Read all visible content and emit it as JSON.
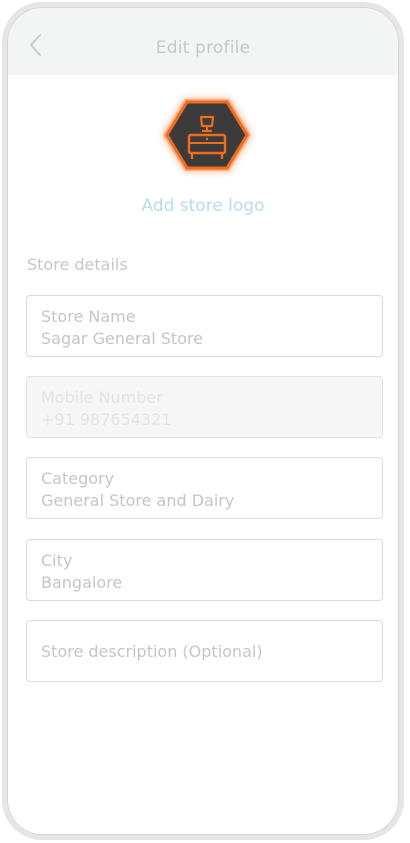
{
  "header": {
    "title": "Edit profile",
    "back_icon": "chevron-left-icon"
  },
  "logo": {
    "icon": "nightstand-lamp-icon",
    "accent_color": "#f26b1d",
    "add_label": "Add store logo"
  },
  "form": {
    "section_title": "Store details",
    "fields": [
      {
        "label": "Store Name",
        "value": "Sagar General Store",
        "disabled": false
      },
      {
        "label": "Mobile Number",
        "value": "+91 987654321",
        "disabled": true
      },
      {
        "label": "Category",
        "value": "General Store and Dairy",
        "disabled": false
      },
      {
        "label": "City",
        "value": "Bangalore",
        "disabled": false
      }
    ],
    "description_placeholder": "Store description (Optional)"
  }
}
